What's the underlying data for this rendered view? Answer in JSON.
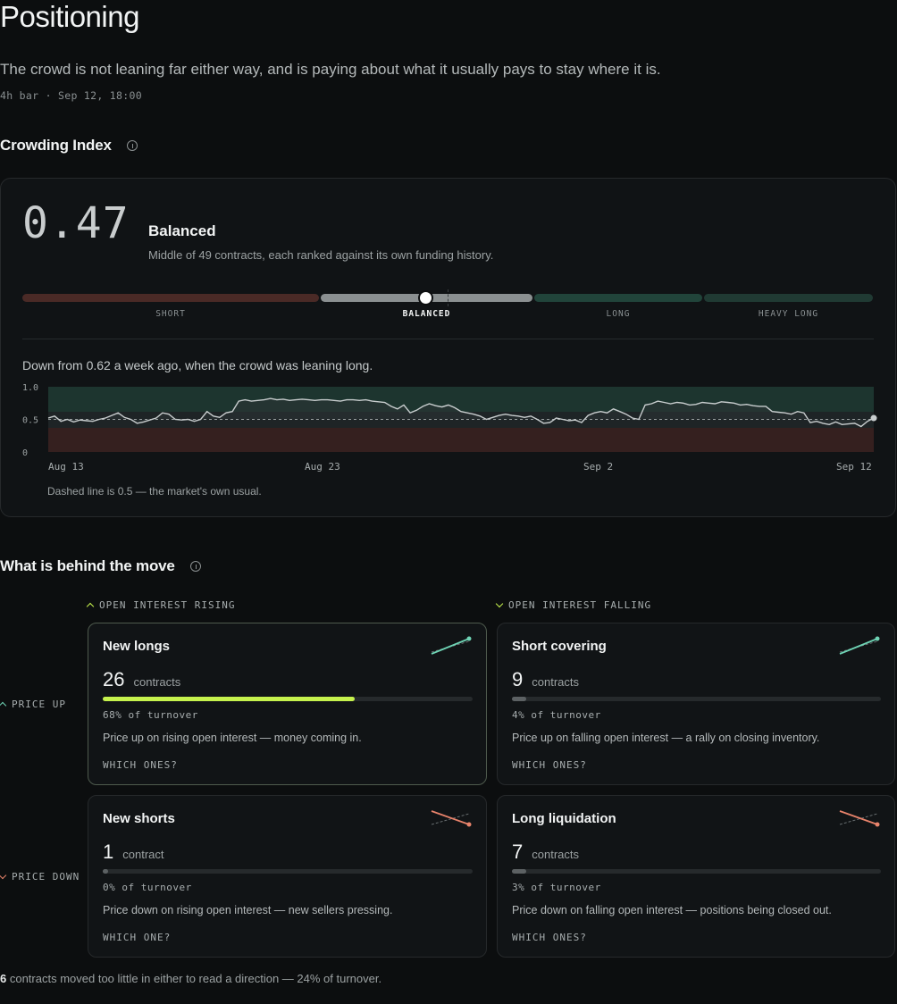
{
  "page": {
    "title": "Positioning",
    "subtitle": "The crowd is not leaning far either way, and is paying about what it usually pays to stay where it is.",
    "meta": "4h bar · Sep 12, 18:00"
  },
  "crowding": {
    "heading": "Crowding Index",
    "value": "0.47",
    "status": "Balanced",
    "description": "Middle of 49 contracts, each ranked against its own funding history.",
    "scale_labels": [
      "SHORT",
      "BALANCED",
      "LONG",
      "HEAVY LONG"
    ],
    "marker_value": 0.47,
    "colors": {
      "short": "#4a2a26",
      "balanced": "#8b9091",
      "long": "#21443a",
      "heavy_long": "#203a33",
      "marker": "#ffffff"
    }
  },
  "chart_data": {
    "type": "line",
    "caption": "Down from 0.62 a week ago, when the crowd was leaning long.",
    "note": "Dashed line is 0.5 — the market's own usual.",
    "y_ticks": [
      "1.0",
      "0.5",
      "0"
    ],
    "ylim": [
      0,
      1
    ],
    "x_ticks": [
      "Aug 13",
      "Aug 23",
      "Sep 2",
      "Sep 12"
    ],
    "reference": 0.5,
    "series": [
      {
        "values": [
          0.52,
          0.55,
          0.47,
          0.5,
          0.46,
          0.49,
          0.48,
          0.47,
          0.5,
          0.52,
          0.56,
          0.6,
          0.53,
          0.5,
          0.44,
          0.46,
          0.49,
          0.52,
          0.6,
          0.58,
          0.5,
          0.49,
          0.5,
          0.47,
          0.5,
          0.62,
          0.55,
          0.53,
          0.6,
          0.62,
          0.78,
          0.8,
          0.78,
          0.79,
          0.8,
          0.82,
          0.8,
          0.81,
          0.79,
          0.8,
          0.81,
          0.8,
          0.79,
          0.8,
          0.8,
          0.79,
          0.78,
          0.8,
          0.8,
          0.79,
          0.8,
          0.78,
          0.77,
          0.76,
          0.7,
          0.66,
          0.72,
          0.6,
          0.64,
          0.7,
          0.74,
          0.71,
          0.69,
          0.72,
          0.68,
          0.62,
          0.6,
          0.58,
          0.55,
          0.5,
          0.53,
          0.56,
          0.58,
          0.56,
          0.55,
          0.53,
          0.55,
          0.5,
          0.44,
          0.45,
          0.52,
          0.5,
          0.48,
          0.49,
          0.45,
          0.56,
          0.6,
          0.62,
          0.6,
          0.66,
          0.62,
          0.58,
          0.52,
          0.5,
          0.72,
          0.74,
          0.78,
          0.76,
          0.74,
          0.76,
          0.75,
          0.72,
          0.73,
          0.76,
          0.75,
          0.74,
          0.77,
          0.76,
          0.75,
          0.72,
          0.73,
          0.71,
          0.7,
          0.7,
          0.62,
          0.61,
          0.6,
          0.58,
          0.62,
          0.6,
          0.45,
          0.47,
          0.44,
          0.42,
          0.46,
          0.42,
          0.43,
          0.44,
          0.39,
          0.47,
          0.52
        ]
      }
    ]
  },
  "quadrants": {
    "heading": "What is behind the move",
    "col_rising": "OPEN INTEREST RISING",
    "col_falling": "OPEN INTEREST FALLING",
    "row_up": "PRICE UP",
    "row_down": "PRICE DOWN",
    "cards": [
      {
        "title": "New longs",
        "count": "26",
        "unit": "contracts",
        "share": 0.68,
        "pct": "68% of turnover",
        "desc": "Price up on rising open interest — money coming in.",
        "link": "WHICH ONES?",
        "bar_color": "#c6f24d",
        "spark": "up"
      },
      {
        "title": "Short covering",
        "count": "9",
        "unit": "contracts",
        "share": 0.04,
        "pct": "4% of turnover",
        "desc": "Price up on falling open interest — a rally on closing inventory.",
        "link": "WHICH ONES?",
        "bar_color": "#5c6163",
        "spark": "up"
      },
      {
        "title": "New shorts",
        "count": "1",
        "unit": "contract",
        "share": 0.01,
        "pct": "0% of turnover",
        "desc": "Price down on rising open interest — new sellers pressing.",
        "link": "WHICH ONE?",
        "bar_color": "#5c6163",
        "spark": "down"
      },
      {
        "title": "Long liquidation",
        "count": "7",
        "unit": "contracts",
        "share": 0.03,
        "pct": "3% of turnover",
        "desc": "Price down on falling open interest — positions being closed out.",
        "link": "WHICH ONES?",
        "bar_color": "#5c6163",
        "spark": "down"
      }
    ],
    "colors": {
      "up": "#6fd4b5",
      "down": "#e8836b"
    }
  },
  "footer": {
    "count": "6",
    "text": " contracts moved too little in either to read a direction — 24% of turnover."
  }
}
